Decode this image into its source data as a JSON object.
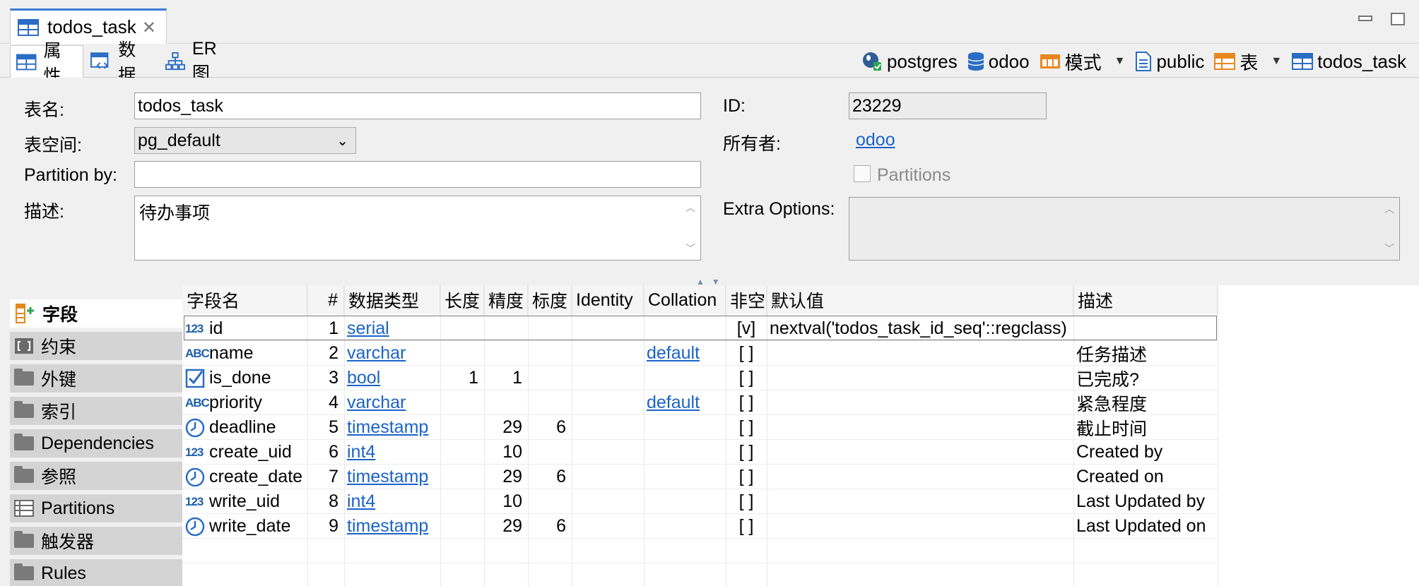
{
  "editor_tab": {
    "title": "todos_task"
  },
  "subtabs": [
    {
      "label": "属性"
    },
    {
      "label": "数据"
    },
    {
      "label": "ER 图"
    }
  ],
  "breadcrumbs": {
    "connection": "postgres",
    "database": "odoo",
    "schema_label": "模式",
    "schema": "public",
    "tables_label": "表",
    "table": "todos_task"
  },
  "form": {
    "table_name_label": "表名:",
    "table_name": "todos_task",
    "id_label": "ID:",
    "id_value": "23229",
    "tablespace_label": "表空间:",
    "tablespace": "pg_default",
    "owner_label": "所有者:",
    "owner": "odoo",
    "partition_by_label": "Partition by:",
    "partition_by": "",
    "partitions_label": "Partitions",
    "description_label": "描述:",
    "description": "待办事项",
    "extra_options_label": "Extra Options:",
    "extra_options": ""
  },
  "sections": [
    {
      "label": "字段"
    },
    {
      "label": "约束"
    },
    {
      "label": "外键"
    },
    {
      "label": "索引"
    },
    {
      "label": "Dependencies"
    },
    {
      "label": "参照"
    },
    {
      "label": "Partitions"
    },
    {
      "label": "触发器"
    },
    {
      "label": "Rules"
    }
  ],
  "columns_table": {
    "headers": [
      "字段名",
      "#",
      "数据类型",
      "长度",
      "精度",
      "标度",
      "Identity",
      "Collation",
      "非空",
      "默认值",
      "描述"
    ],
    "rows": [
      {
        "icon": "123",
        "name": "id",
        "num": "1",
        "type": "serial",
        "length": "",
        "precision": "",
        "scale": "",
        "identity": "",
        "collation": "",
        "notnull": "[v]",
        "default": "nextval('todos_task_id_seq'::regclass)",
        "desc": ""
      },
      {
        "icon": "ABC",
        "name": "name",
        "num": "2",
        "type": "varchar",
        "length": "",
        "precision": "",
        "scale": "",
        "identity": "",
        "collation": "default",
        "notnull": "[ ]",
        "default": "",
        "desc": "任务描述"
      },
      {
        "icon": "bool",
        "name": "is_done",
        "num": "3",
        "type": "bool",
        "length": "1",
        "precision": "1",
        "scale": "",
        "identity": "",
        "collation": "",
        "notnull": "[ ]",
        "default": "",
        "desc": "已完成?"
      },
      {
        "icon": "ABC",
        "name": "priority",
        "num": "4",
        "type": "varchar",
        "length": "",
        "precision": "",
        "scale": "",
        "identity": "",
        "collation": "default",
        "notnull": "[ ]",
        "default": "",
        "desc": "紧急程度"
      },
      {
        "icon": "clock",
        "name": "deadline",
        "num": "5",
        "type": "timestamp",
        "length": "",
        "precision": "29",
        "scale": "6",
        "identity": "",
        "collation": "",
        "notnull": "[ ]",
        "default": "",
        "desc": "截止时间"
      },
      {
        "icon": "123",
        "name": "create_uid",
        "num": "6",
        "type": "int4",
        "length": "",
        "precision": "10",
        "scale": "",
        "identity": "",
        "collation": "",
        "notnull": "[ ]",
        "default": "",
        "desc": "Created by"
      },
      {
        "icon": "clock",
        "name": "create_date",
        "num": "7",
        "type": "timestamp",
        "length": "",
        "precision": "29",
        "scale": "6",
        "identity": "",
        "collation": "",
        "notnull": "[ ]",
        "default": "",
        "desc": "Created on"
      },
      {
        "icon": "123",
        "name": "write_uid",
        "num": "8",
        "type": "int4",
        "length": "",
        "precision": "10",
        "scale": "",
        "identity": "",
        "collation": "",
        "notnull": "[ ]",
        "default": "",
        "desc": "Last Updated by"
      },
      {
        "icon": "clock",
        "name": "write_date",
        "num": "9",
        "type": "timestamp",
        "length": "",
        "precision": "29",
        "scale": "6",
        "identity": "",
        "collation": "",
        "notnull": "[ ]",
        "default": "",
        "desc": "Last Updated on"
      }
    ]
  },
  "colors": {
    "accent": "#3a7bd5",
    "link": "#1a63c8",
    "icon_blue": "#1f5fa8",
    "icon_orange": "#e8871e"
  }
}
